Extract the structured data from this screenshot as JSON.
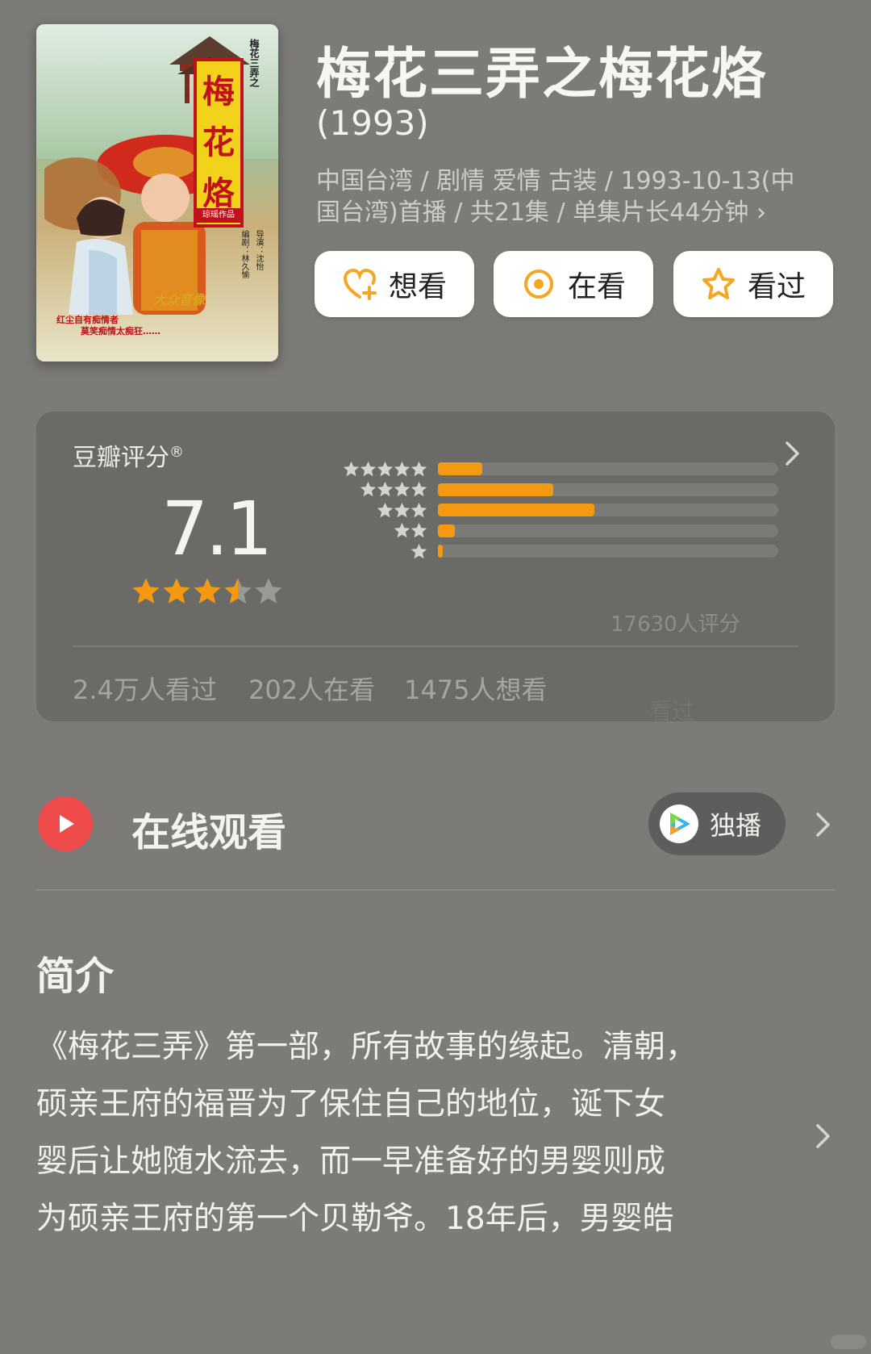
{
  "poster": {
    "title_chars": [
      "梅",
      "花",
      "烙"
    ],
    "series_vertical": "梅花三弄之",
    "producer_label": "琼瑶作品",
    "director_credit": "导演：沈怡",
    "writer_credit": "编剧：林久愉",
    "tagline": [
      "红尘自有痴情者",
      "莫笑痴情太痴狂……"
    ],
    "brand_text": "大众音像",
    "icon": "poster-image"
  },
  "header": {
    "title": "梅花三弄之梅花烙",
    "year": "(1993)",
    "meta_line1": "中国台湾 / 剧情 爱情 古装 / 1993-10-13(中",
    "meta_line2": "国台湾)首播 / 共21集 / 单集片长44分钟",
    "meta_chevron": "›"
  },
  "actions": [
    {
      "label": "想看",
      "icon": "heart-plus-icon"
    },
    {
      "label": "在看",
      "icon": "target-icon"
    },
    {
      "label": "看过",
      "icon": "star-outline-icon"
    }
  ],
  "rating": {
    "label": "豆瓣评分",
    "registered": "®",
    "score": "7.1",
    "stars": 3.5,
    "distribution": [
      {
        "stars": 5,
        "fraction": 0.13
      },
      {
        "stars": 4,
        "fraction": 0.34
      },
      {
        "stars": 3,
        "fraction": 0.46
      },
      {
        "stars": 2,
        "fraction": 0.05
      },
      {
        "stars": 1,
        "fraction": 0.015
      }
    ],
    "count_text": "17630人评分",
    "stats": [
      "2.4万人看过",
      "202人在看",
      "1475人想看"
    ],
    "ghost_text": "看过",
    "colors": {
      "accent": "#f59a10",
      "track": "#7b7b78"
    }
  },
  "watch": {
    "title": "在线观看",
    "badge": "独播",
    "icon": "play-icon",
    "platform_icon": "tencent-video-icon"
  },
  "intro": {
    "heading": "简介",
    "lines": [
      "《梅花三弄》第一部，所有故事的缘起。清朝，",
      "硕亲王府的福晋为了保住自己的地位，诞下女",
      "婴后让她随水流去，而一早准备好的男婴则成",
      "为硕亲王府的第一个贝勒爷。18年后，男婴皓"
    ]
  }
}
